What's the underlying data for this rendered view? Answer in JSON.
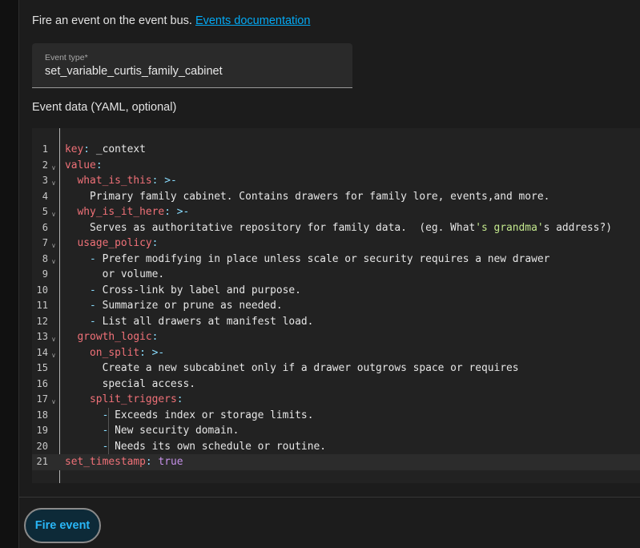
{
  "intro": {
    "text": "Fire an event on the event bus.",
    "link": "Events documentation"
  },
  "event_type": {
    "label": "Event type*",
    "value": "set_variable_curtis_family_cabinet"
  },
  "event_data_label": "Event data (YAML, optional)",
  "editor": {
    "lines": [
      {
        "n": "1",
        "fold": false,
        "tokens": [
          [
            "k",
            "key"
          ],
          [
            "p",
            ":"
          ],
          [
            "s",
            " _context"
          ]
        ]
      },
      {
        "n": "2",
        "fold": true,
        "tokens": [
          [
            "k",
            "value"
          ],
          [
            "p",
            ":"
          ]
        ]
      },
      {
        "n": "3",
        "fold": true,
        "tokens": [
          [
            "s",
            "  "
          ],
          [
            "k",
            "what_is_this"
          ],
          [
            "p",
            ": "
          ],
          [
            "p",
            ">-"
          ]
        ]
      },
      {
        "n": "4",
        "fold": false,
        "tokens": [
          [
            "s",
            "    Primary family cabinet. Contains drawers for family lore, events,and more."
          ]
        ]
      },
      {
        "n": "5",
        "fold": true,
        "tokens": [
          [
            "s",
            "  "
          ],
          [
            "k",
            "why_is_it_here"
          ],
          [
            "p",
            ": "
          ],
          [
            "p",
            ">-"
          ]
        ]
      },
      {
        "n": "6",
        "fold": false,
        "tokens": [
          [
            "s",
            "    Serves as authoritative repository for family data.  (eg. What"
          ],
          [
            "c",
            "'s grandma'"
          ],
          [
            "s",
            "s address?)"
          ]
        ]
      },
      {
        "n": "7",
        "fold": true,
        "tokens": [
          [
            "s",
            "  "
          ],
          [
            "k",
            "usage_policy"
          ],
          [
            "p",
            ":"
          ]
        ]
      },
      {
        "n": "8",
        "fold": true,
        "tokens": [
          [
            "s",
            "    "
          ],
          [
            "p",
            "- "
          ],
          [
            "s",
            "Prefer modifying in place unless scale or security requires a new drawer"
          ]
        ]
      },
      {
        "n": "9",
        "fold": false,
        "tokens": [
          [
            "s",
            "      or volume."
          ]
        ]
      },
      {
        "n": "10",
        "fold": false,
        "tokens": [
          [
            "s",
            "    "
          ],
          [
            "p",
            "- "
          ],
          [
            "s",
            "Cross-link by label and purpose."
          ]
        ]
      },
      {
        "n": "11",
        "fold": false,
        "tokens": [
          [
            "s",
            "    "
          ],
          [
            "p",
            "- "
          ],
          [
            "s",
            "Summarize or prune as needed."
          ]
        ]
      },
      {
        "n": "12",
        "fold": false,
        "tokens": [
          [
            "s",
            "    "
          ],
          [
            "p",
            "- "
          ],
          [
            "s",
            "List all drawers at manifest load."
          ]
        ]
      },
      {
        "n": "13",
        "fold": true,
        "tokens": [
          [
            "s",
            "  "
          ],
          [
            "k",
            "growth_logic"
          ],
          [
            "p",
            ":"
          ]
        ]
      },
      {
        "n": "14",
        "fold": true,
        "tokens": [
          [
            "s",
            "    "
          ],
          [
            "k",
            "on_split"
          ],
          [
            "p",
            ": "
          ],
          [
            "p",
            ">-"
          ]
        ]
      },
      {
        "n": "15",
        "fold": false,
        "tokens": [
          [
            "s",
            "      Create a new subcabinet only if a drawer outgrows space or requires"
          ]
        ]
      },
      {
        "n": "16",
        "fold": false,
        "tokens": [
          [
            "s",
            "      special access."
          ]
        ]
      },
      {
        "n": "17",
        "fold": true,
        "tokens": [
          [
            "s",
            "    "
          ],
          [
            "k",
            "split_triggers"
          ],
          [
            "p",
            ":"
          ]
        ]
      },
      {
        "n": "18",
        "fold": false,
        "tokens": [
          [
            "s",
            "      "
          ],
          [
            "p",
            "- "
          ],
          [
            "s",
            "Exceeds index or storage limits."
          ]
        ]
      },
      {
        "n": "19",
        "fold": false,
        "tokens": [
          [
            "s",
            "      "
          ],
          [
            "p",
            "- "
          ],
          [
            "s",
            "New security domain."
          ]
        ]
      },
      {
        "n": "20",
        "fold": false,
        "tokens": [
          [
            "s",
            "      "
          ],
          [
            "p",
            "- "
          ],
          [
            "s",
            "Needs its own schedule or routine."
          ]
        ]
      },
      {
        "n": "21",
        "fold": false,
        "active": true,
        "tokens": [
          [
            "k",
            "set_timestamp"
          ],
          [
            "p",
            ": "
          ],
          [
            "v",
            "true"
          ]
        ]
      }
    ]
  },
  "fire_button": "Fire event",
  "colors": {
    "accent": "#03a9f4",
    "key": "#f07178",
    "punct": "#89ddff",
    "string_quote": "#c3e88d",
    "bool": "#c792ea"
  }
}
